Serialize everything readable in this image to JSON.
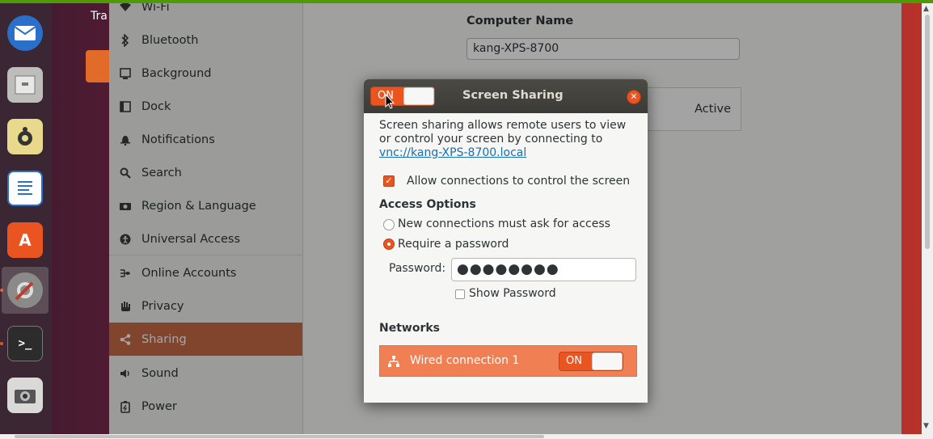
{
  "desktop": {
    "trash_label": "Tra"
  },
  "dock": {
    "items": [
      {
        "name": "Thunderbird",
        "icon": "thunderbird-icon"
      },
      {
        "name": "Files",
        "icon": "files-icon"
      },
      {
        "name": "Rhythmbox",
        "icon": "rhythmbox-icon"
      },
      {
        "name": "LibreOffice Writer",
        "icon": "writer-icon"
      },
      {
        "name": "Ubuntu Software",
        "icon": "software-icon"
      },
      {
        "name": "Settings",
        "icon": "settings-icon"
      },
      {
        "name": "Terminal",
        "icon": "terminal-icon"
      },
      {
        "name": "Screenshot",
        "icon": "camera-icon"
      }
    ]
  },
  "sidebar": {
    "items": [
      {
        "label": "Wi-Fi",
        "icon": "wifi-icon"
      },
      {
        "label": "Bluetooth",
        "icon": "bluetooth-icon"
      },
      {
        "label": "Background",
        "icon": "background-icon"
      },
      {
        "label": "Dock",
        "icon": "dock-icon"
      },
      {
        "label": "Notifications",
        "icon": "bell-icon"
      },
      {
        "label": "Search",
        "icon": "search-icon"
      },
      {
        "label": "Region & Language",
        "icon": "camera-icon"
      },
      {
        "label": "Universal Access",
        "icon": "accessibility-icon"
      },
      {
        "label": "Online Accounts",
        "icon": "accounts-icon"
      },
      {
        "label": "Privacy",
        "icon": "hand-icon"
      },
      {
        "label": "Sharing",
        "icon": "share-icon",
        "selected": true
      },
      {
        "label": "Sound",
        "icon": "speaker-icon"
      },
      {
        "label": "Power",
        "icon": "power-icon"
      }
    ]
  },
  "main": {
    "computer_name_label": "Computer Name",
    "computer_name_value": "kang-XPS-8700",
    "status_text": "Active"
  },
  "dialog": {
    "title": "Screen Sharing",
    "toggle_label": "ON",
    "description": "Screen sharing allows remote users to view or control your screen by connecting to ",
    "link": "vnc://kang-XPS-8700.local",
    "allow_control_label": "Allow connections to control the screen",
    "allow_control_checked": true,
    "access_options_heading": "Access Options",
    "option_ask_label": "New connections must ask for access",
    "option_password_label": "Require a password",
    "selected_option": "password",
    "password_label": "Password:",
    "password_value": "●●●●●●●●",
    "show_password_label": "Show Password",
    "show_password_checked": false,
    "networks_heading": "Networks",
    "network_name": "Wired connection 1",
    "network_toggle_label": "ON"
  },
  "colors": {
    "accent": "#e95420",
    "selected_row": "#c66a46",
    "network_row": "#f07f53"
  }
}
